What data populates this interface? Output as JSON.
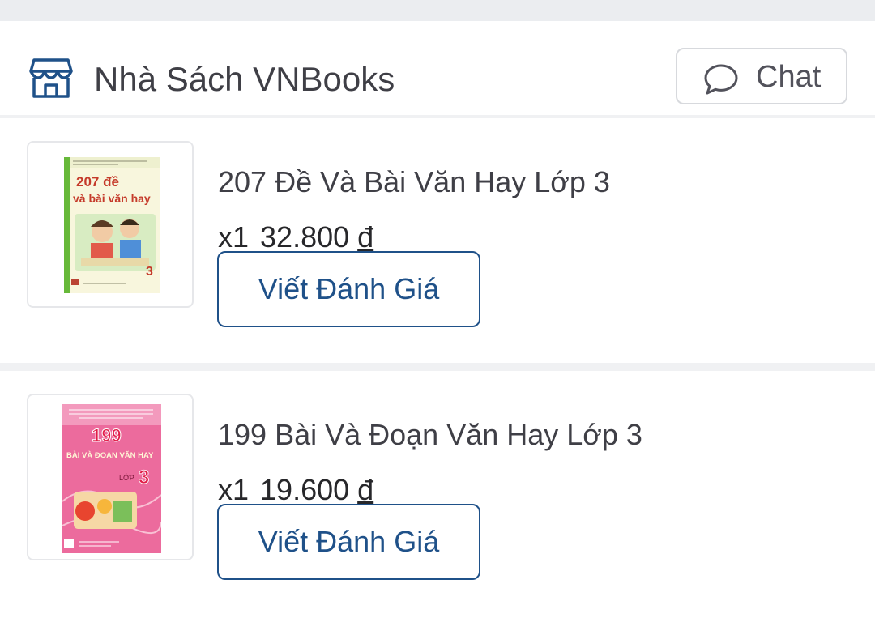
{
  "shop": {
    "icon": "store-icon",
    "name": "Nhà Sách VNBooks",
    "chat": {
      "icon": "chat-bubble-icon",
      "label": "Chat"
    }
  },
  "items": [
    {
      "title": "207 Đề Và Bài Văn Hay Lớp 3",
      "quantity": "x1",
      "price": "32.800",
      "currency": "đ",
      "review_button": "Viết Đánh Giá",
      "cover": {
        "number_text": "207 đề",
        "subtitle_text": "và bài văn hay",
        "grade_text": "3"
      }
    },
    {
      "title": "199 Bài Và Đoạn Văn Hay Lớp 3",
      "quantity": "x1",
      "price": "19.600",
      "currency": "đ",
      "review_button": "Viết Đánh Giá",
      "cover": {
        "number_text": "199",
        "subtitle_text": "BÀI VÀ ĐOẠN VĂN HAY",
        "grade_prefix": "LỚP",
        "grade_text": "3"
      }
    }
  ],
  "colors": {
    "accent": "#1f5189",
    "background": "#ebedf0",
    "card": "#ffffff"
  }
}
